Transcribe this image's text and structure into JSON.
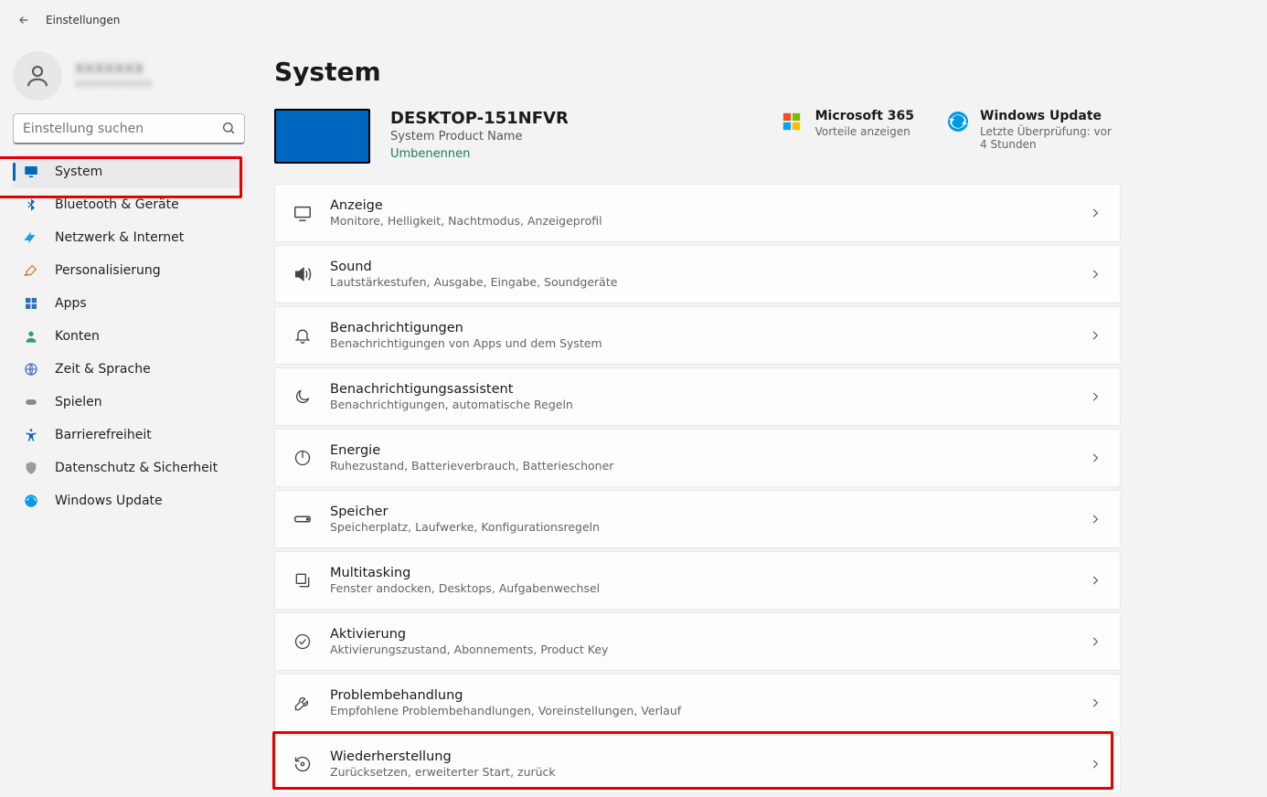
{
  "titlebar": {
    "title": "Einstellungen"
  },
  "account": {
    "name": "XXXXXXX",
    "sub": "xxxxxxxxxxxx"
  },
  "search": {
    "placeholder": "Einstellung suchen"
  },
  "nav": [
    {
      "label": "System",
      "icon": "monitor",
      "color": "#0067c0",
      "selected": true
    },
    {
      "label": "Bluetooth & Geräte",
      "icon": "bluetooth",
      "color": "#0067c0"
    },
    {
      "label": "Netzwerk & Internet",
      "icon": "wifi",
      "color": "#1aa2d4"
    },
    {
      "label": "Personalisierung",
      "icon": "brush",
      "color": "#d87a2b"
    },
    {
      "label": "Apps",
      "icon": "apps",
      "color": "#3070c0"
    },
    {
      "label": "Konten",
      "icon": "person",
      "color": "#2aa06a"
    },
    {
      "label": "Zeit & Sprache",
      "icon": "globe",
      "color": "#4a74c8"
    },
    {
      "label": "Spielen",
      "icon": "gamepad",
      "color": "#888"
    },
    {
      "label": "Barrierefreiheit",
      "icon": "accessibility",
      "color": "#0067c0"
    },
    {
      "label": "Datenschutz & Sicherheit",
      "icon": "shield",
      "color": "#9a9a9a"
    },
    {
      "label": "Windows Update",
      "icon": "update",
      "color": "#0099e5"
    }
  ],
  "page": {
    "title": "System"
  },
  "device": {
    "name": "DESKTOP-151NFVR",
    "product": "System Product Name",
    "rename": "Umbenennen"
  },
  "promos": [
    {
      "title": "Microsoft 365",
      "sub": "Vorteile anzeigen",
      "icon": "ms"
    },
    {
      "title": "Windows Update",
      "sub": "Letzte Überprüfung: vor 4 Stunden",
      "icon": "wu"
    }
  ],
  "rows": [
    {
      "icon": "display",
      "title": "Anzeige",
      "sub": "Monitore, Helligkeit, Nachtmodus, Anzeigeprofil"
    },
    {
      "icon": "sound",
      "title": "Sound",
      "sub": "Lautstärkestufen, Ausgabe, Eingabe, Soundgeräte"
    },
    {
      "icon": "bell",
      "title": "Benachrichtigungen",
      "sub": "Benachrichtigungen von Apps und dem System"
    },
    {
      "icon": "moon",
      "title": "Benachrichtigungsassistent",
      "sub": "Benachrichtigungen, automatische Regeln"
    },
    {
      "icon": "power",
      "title": "Energie",
      "sub": "Ruhezustand, Batterieverbrauch, Batterieschoner"
    },
    {
      "icon": "storage",
      "title": "Speicher",
      "sub": "Speicherplatz, Laufwerke, Konfigurationsregeln"
    },
    {
      "icon": "multitask",
      "title": "Multitasking",
      "sub": "Fenster andocken, Desktops, Aufgabenwechsel"
    },
    {
      "icon": "check",
      "title": "Aktivierung",
      "sub": "Aktivierungszustand, Abonnements, Product Key"
    },
    {
      "icon": "wrench",
      "title": "Problembehandlung",
      "sub": "Empfohlene Problembehandlungen, Voreinstellungen, Verlauf"
    },
    {
      "icon": "recovery",
      "title": "Wiederherstellung",
      "sub": "Zurücksetzen, erweiterter Start, zurück"
    }
  ]
}
